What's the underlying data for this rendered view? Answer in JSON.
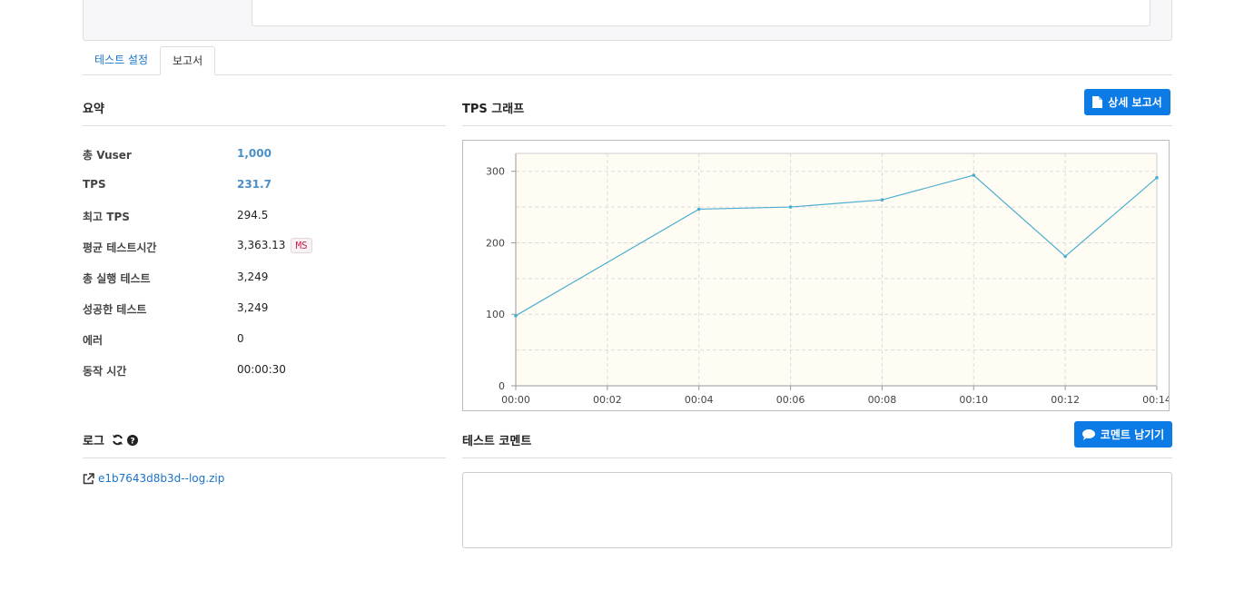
{
  "tabs": [
    {
      "label": "테스트 설정"
    },
    {
      "label": "보고서"
    }
  ],
  "summary": {
    "title": "요약",
    "rows": [
      {
        "label": "총 Vuser",
        "value": "1,000"
      },
      {
        "label": "TPS",
        "value": "231.7"
      },
      {
        "label": "최고 TPS",
        "value": "294.5"
      },
      {
        "label": "평균 테스트시간",
        "value": "3,363.13",
        "unit": "MS"
      },
      {
        "label": "총 실행 테스트",
        "value": "3,249"
      },
      {
        "label": "성공한 테스트",
        "value": "3,249"
      },
      {
        "label": "에러",
        "value": "0"
      },
      {
        "label": "동작 시간",
        "value": "00:00:30"
      }
    ]
  },
  "tps_graph": {
    "title": "TPS 그래프",
    "report_button": "상세 보고서"
  },
  "log": {
    "title": "로그",
    "file": "e1b7643d8b3d--log.zip"
  },
  "comment": {
    "title": "테스트 코멘트",
    "button": "코멘트 남기기"
  },
  "colors": {
    "accent": "#0d7be6",
    "line": "#4aaed0",
    "plot_bg": "#fffcf3"
  },
  "chart_data": {
    "type": "line",
    "x": [
      "00:00",
      "00:04",
      "00:06",
      "00:08",
      "00:10",
      "00:12",
      "00:14"
    ],
    "x_minutes": [
      0,
      4,
      6,
      8,
      10,
      12,
      14
    ],
    "series": [
      {
        "values": [
          98,
          247,
          250,
          260,
          294.5,
          181,
          291
        ]
      }
    ],
    "x_ticks": [
      "00:00",
      "00:02",
      "00:04",
      "00:06",
      "00:08",
      "00:10",
      "00:12",
      "00:14"
    ],
    "y_ticks": [
      "0",
      "100",
      "200",
      "300"
    ],
    "xlim": [
      0,
      14
    ],
    "ylim": [
      0,
      325
    ],
    "grid": true
  }
}
